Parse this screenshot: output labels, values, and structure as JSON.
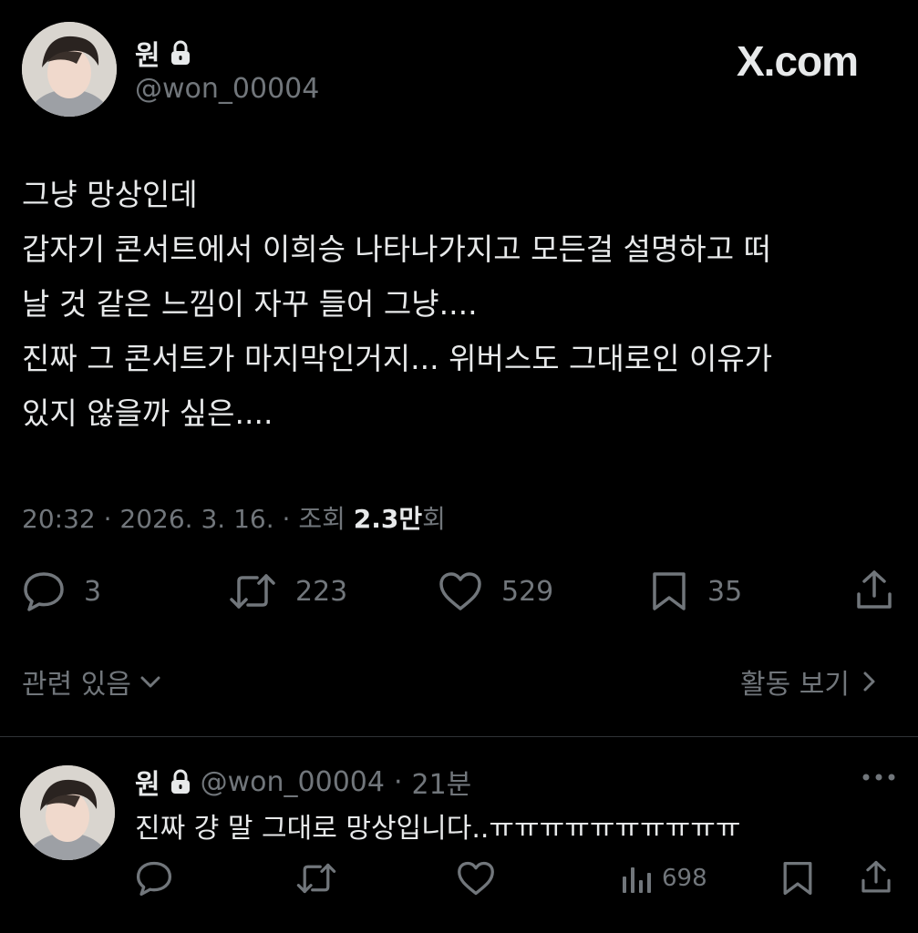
{
  "author": {
    "name": "원",
    "handle": "@won_00004"
  },
  "brand": "X.com",
  "tweet": {
    "lines": [
      "그냥 망상인데",
      "갑자기 콘서트에서 이희승 나타나가지고 모든걸 설명하고 떠",
      "날 것 같은 느낌이 자꾸 들어 그냥....",
      "진짜 그 콘서트가 마지막인거지... 위버스도 그대로인 이유가",
      "있지 않을까 싶은...."
    ],
    "time": "20:32",
    "date": "2026. 3. 16.",
    "views_label": "조회",
    "views_value": "2.3만",
    "views_suffix": "회",
    "sep": "·"
  },
  "actions": {
    "replies": "3",
    "retweets": "223",
    "likes": "529",
    "bookmarks": "35"
  },
  "related": {
    "left_label": "관련 있음",
    "right_label": "활동 보기"
  },
  "reply": {
    "name": "원",
    "handle": "@won_00004",
    "time": "21분",
    "sep": "·",
    "text": "진짜 걍 말 그대로 망상입니다..ㅠㅠㅠㅠㅠㅠㅠㅠㅠㅠ",
    "views": "698"
  },
  "colors": {
    "background": "#000000",
    "text": "#e7e9ea",
    "secondary": "#71767b",
    "divider": "#2f3336"
  }
}
